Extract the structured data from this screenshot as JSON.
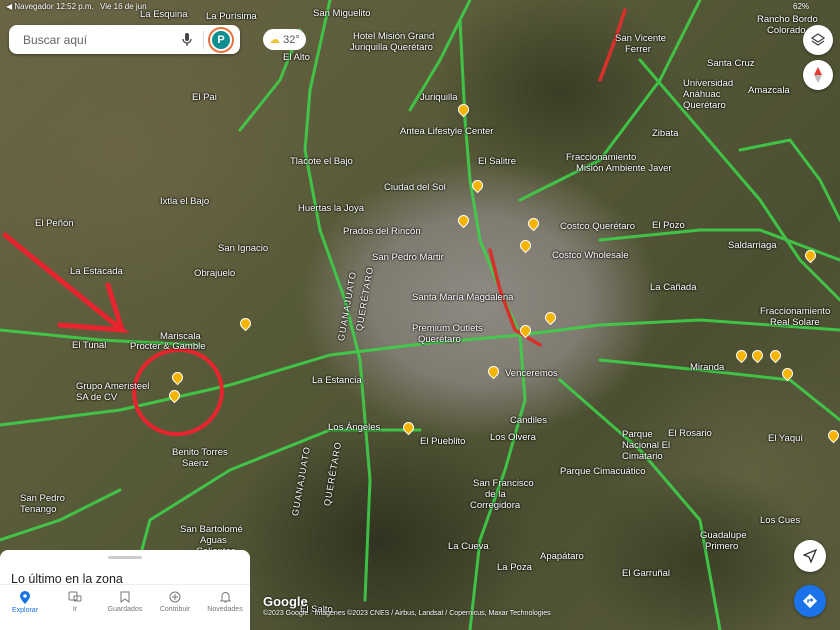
{
  "status_bar": {
    "back": "◀ Navegador",
    "time": "12:52 p.m.",
    "date": "Vie 16 de jun",
    "battery": "62%"
  },
  "search": {
    "placeholder": "Buscar aquí",
    "avatar_letter": "P"
  },
  "weather": {
    "temp": "32°"
  },
  "map_labels": [
    "La Esquina",
    "La Purísima",
    "San Miguelito",
    "Hotel Misión Grand",
    "Juriquilla Querétaro",
    "El Alto",
    "El Pai",
    "Juriquilla",
    "Antea Lifestyle Center",
    "Tlacote el Bajo",
    "Ciudad del Sol",
    "Huertas la Joya",
    "Prados del Rincón",
    "San Pedro Mártir",
    "Santa María Magdalena",
    "El Salitre",
    "Fraccionamiento",
    "Misión Ambiente Javer",
    "Costco Querétaro",
    "Costco Wholesale",
    "El Pozo",
    "Zibata",
    "Universidad",
    "Anáhuac",
    "Querétaro",
    "San Vicente",
    "Ferrer",
    "Santa Cruz",
    "Amazcala",
    "Rancho Bordo",
    "Colorado",
    "La Cañada",
    "Saldarriaga",
    "Fraccionamiento",
    "Real Solare",
    "Miranda",
    "El Yaquí",
    "El Rosario",
    "Parque",
    "Nacional El",
    "Cimatario",
    "Parque Cimacuático",
    "Los Cues",
    "Guadalupe",
    "Primero",
    "El Garruñal",
    "Apapátaro",
    "La Poza",
    "La Cueva",
    "San Francisco",
    "de la",
    "Corregidora",
    "El Pueblito",
    "Los Olvera",
    "Candiles",
    "Venceremos",
    "Premium Outlets",
    "Querétaro",
    "Los Ángeles",
    "La Estancia",
    "Obrajuelo",
    "San Ignacio",
    "Mariscala",
    "Procter & Gamble",
    "El Tunal",
    "Grupo Ameristeel",
    "SA de CV",
    "La Estacada",
    "El Peñón",
    "Ixtla el Bajo",
    "Benito Torres",
    "Saenz",
    "San Pedro",
    "Tenango",
    "San Bartolomé",
    "Aguas",
    "Calientes",
    "El Salto"
  ],
  "vertical_labels": [
    "GUANAJUATO",
    "QUERÉTARO",
    "GUANAJUATO",
    "QUERÉTARO"
  ],
  "google_logo": "Google",
  "copyright": "©2023 Google · Imágenes ©2023 CNES / Airbus, Landsat / Copernicus, Maxar Technologies",
  "sheet": {
    "title": "Lo último en la zona"
  },
  "nav": [
    {
      "label": "Explorar",
      "active": true
    },
    {
      "label": "Ir"
    },
    {
      "label": "Guardados"
    },
    {
      "label": "Contribuir"
    },
    {
      "label": "Novedades"
    }
  ],
  "colors": {
    "traffic_green": "#3fcf4a",
    "traffic_red": "#d9302c",
    "accent": "#1a73e8",
    "annotation": "#e8242e"
  }
}
